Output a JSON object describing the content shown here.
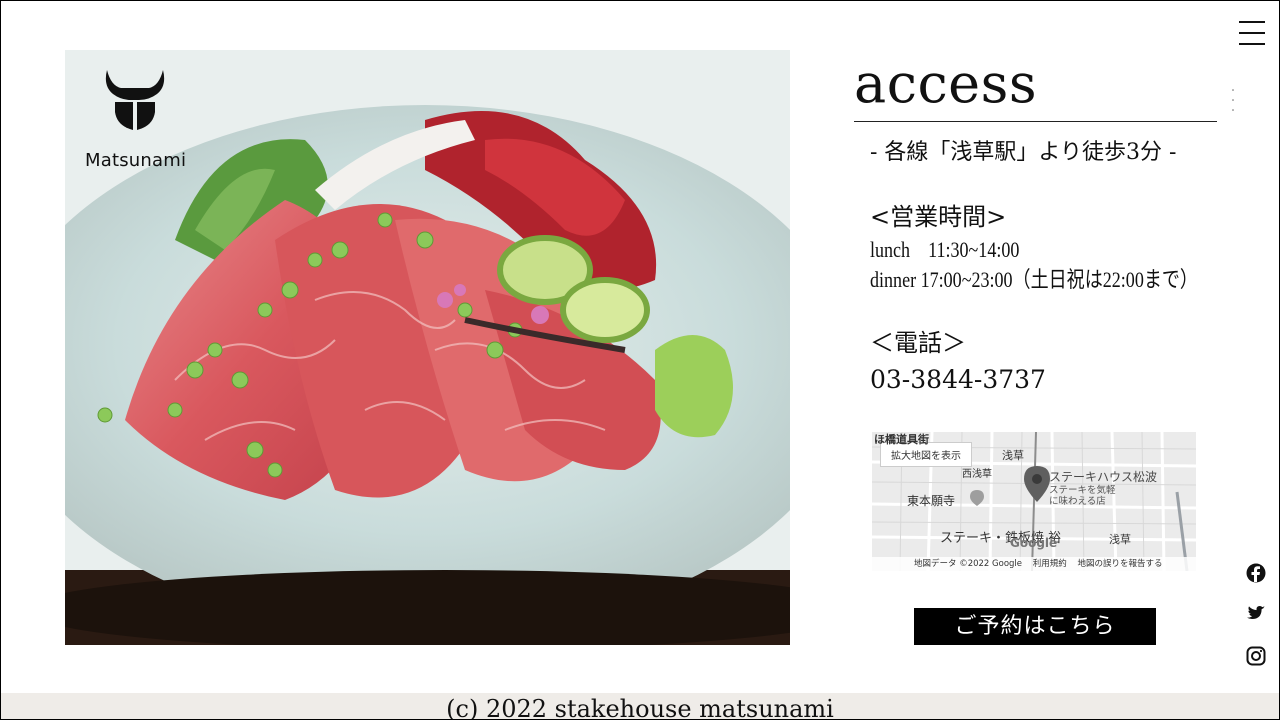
{
  "brand": {
    "logo_text": "Matsunami"
  },
  "access": {
    "title": "access",
    "station": "- 各線「浅草駅」より徒歩3分 -",
    "hours_heading": "<営業時間>",
    "lunch": "lunch　11:30~14:00",
    "dinner": "dinner  17:00~23:00（土日祝は22:00まで）",
    "phone_heading": "＜電話＞",
    "phone": "03-3844-3737"
  },
  "map": {
    "enlarge_label": "拡大地図を表示",
    "area_label": "浅草",
    "district_label": "西浅草",
    "place_name": "ステーキハウス松波",
    "place_caption_line1": "ステーキを気軽",
    "place_caption_line2": "に味わえる店",
    "temple_label": "東本願寺",
    "nearby_label": "ステーキ・鉄板焼 裕",
    "street_label": "浅草",
    "top_label": "ほ橋道具街",
    "google_label": "Google",
    "footer_data": "地図データ ©2022 Google",
    "footer_terms": "利用規約",
    "footer_report": "地図の誤りを報告する"
  },
  "reserve_label": "ご予約はこちら",
  "social": {
    "facebook": "facebook-icon",
    "twitter": "twitter-icon",
    "instagram": "instagram-icon"
  },
  "footer": {
    "copyright": "(c) 2022 stakehouse matsunami"
  },
  "colors": {
    "button_bg": "#000000",
    "footer_bg": "#efece8"
  }
}
